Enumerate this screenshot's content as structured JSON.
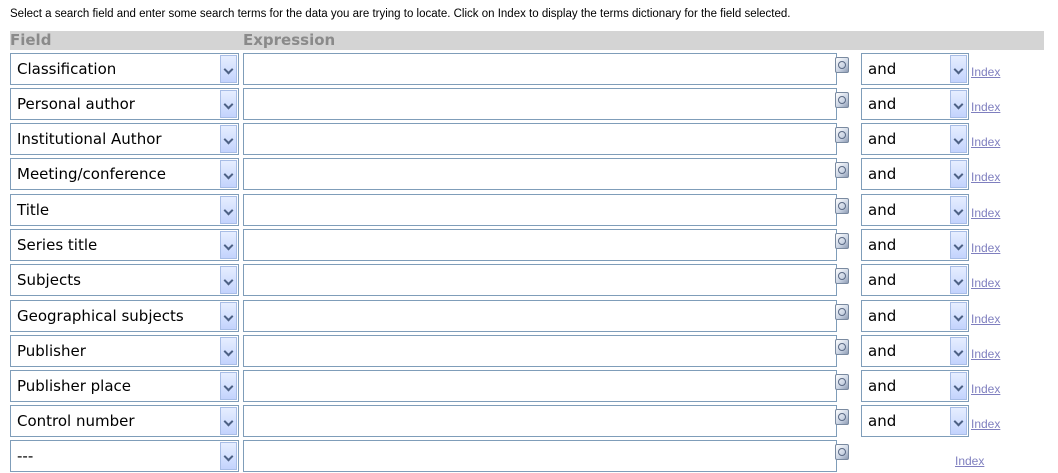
{
  "instructions": "Select a search field and enter some search terms for the data you are trying to locate. Click on Index to display the terms dictionary for the field selected.",
  "headers": {
    "field": "Field",
    "expression": "Expression"
  },
  "rows": [
    {
      "field": "Classification",
      "expression": "",
      "bool": "and",
      "index": "Index"
    },
    {
      "field": "Personal author",
      "expression": "",
      "bool": "and",
      "index": "Index"
    },
    {
      "field": "Institutional Author",
      "expression": "",
      "bool": "and",
      "index": "Index"
    },
    {
      "field": "Meeting/conference",
      "expression": "",
      "bool": "and",
      "index": "Index"
    },
    {
      "field": "Title",
      "expression": "",
      "bool": "and",
      "index": "Index"
    },
    {
      "field": "Series title",
      "expression": "",
      "bool": "and",
      "index": "Index"
    },
    {
      "field": "Subjects",
      "expression": "",
      "bool": "and",
      "index": "Index"
    },
    {
      "field": "Geographical subjects",
      "expression": "",
      "bool": "and",
      "index": "Index"
    },
    {
      "field": "Publisher",
      "expression": "",
      "bool": "and",
      "index": "Index"
    },
    {
      "field": "Publisher place",
      "expression": "",
      "bool": "and",
      "index": "Index"
    },
    {
      "field": "Control number",
      "expression": "",
      "bool": "and",
      "index": "Index"
    },
    {
      "field": "---",
      "expression": "",
      "bool": null,
      "index": "Index"
    }
  ],
  "colors": {
    "input_border": "#7f9db9",
    "header_bg": "#d4d4d4",
    "header_text": "#8a8a8a",
    "link": "#7f7fbf"
  },
  "icons": {
    "dropdown": "chevron-down-icon",
    "dictionary": "dictionary-icon"
  }
}
